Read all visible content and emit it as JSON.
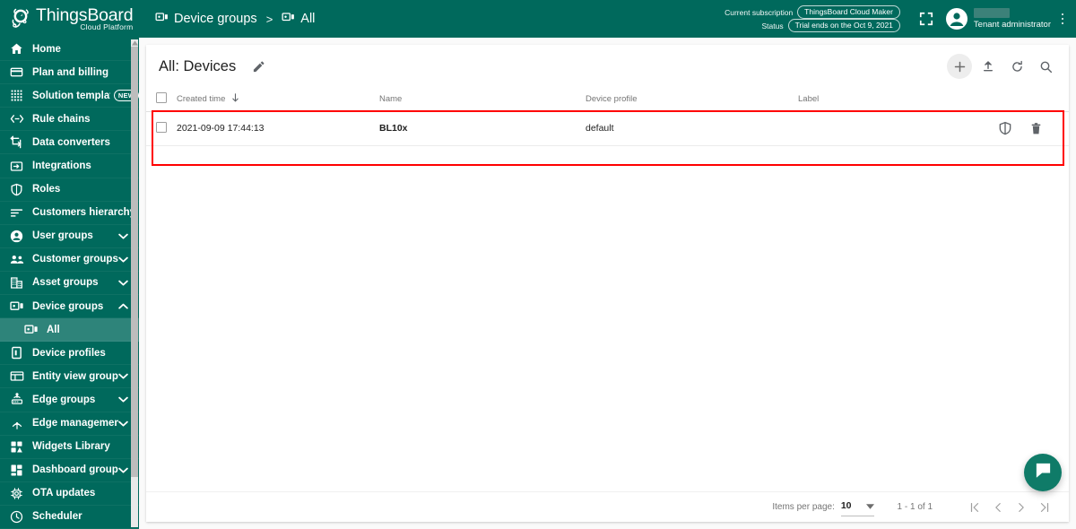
{
  "brand": {
    "name": "ThingsBoard",
    "tagline": "Cloud Platform",
    "accent_color": "#00695C",
    "active_item_color": "#2e847a",
    "highlight_color": "#ff0000",
    "chat_color": "#0f7b68"
  },
  "breadcrumb": [
    {
      "label": "Device groups",
      "icon": "device-groups-icon"
    },
    {
      "label": "All",
      "icon": "device-groups-icon"
    }
  ],
  "breadcrumb_separator": ">",
  "subscription": {
    "current_label": "Current subscription",
    "current_value": "ThingsBoard Cloud Maker",
    "status_label": "Status",
    "status_value": "Trial ends on the Oct 9, 2021"
  },
  "user": {
    "role": "Tenant administrator",
    "name_redacted": true
  },
  "sidebar": {
    "items": [
      {
        "label": "Home",
        "icon": "home-icon",
        "expandable": false,
        "active": false,
        "child": false
      },
      {
        "label": "Plan and billing",
        "icon": "credit-card-icon",
        "expandable": false,
        "active": false,
        "child": false
      },
      {
        "label": "Solution templates",
        "icon": "grid-dots-icon",
        "expandable": false,
        "active": false,
        "child": false,
        "badge": "NEW"
      },
      {
        "label": "Rule chains",
        "icon": "rule-chains-icon",
        "expandable": false,
        "active": false,
        "child": false
      },
      {
        "label": "Data converters",
        "icon": "data-converters-icon",
        "expandable": false,
        "active": false,
        "child": false
      },
      {
        "label": "Integrations",
        "icon": "integrations-icon",
        "expandable": false,
        "active": false,
        "child": false
      },
      {
        "label": "Roles",
        "icon": "shield-icon",
        "expandable": false,
        "active": false,
        "child": false
      },
      {
        "label": "Customers hierarchy",
        "icon": "hierarchy-icon",
        "expandable": false,
        "active": false,
        "child": false
      },
      {
        "label": "User groups",
        "icon": "user-icon",
        "expandable": true,
        "expanded": false,
        "active": false,
        "child": false
      },
      {
        "label": "Customer groups",
        "icon": "users-icon",
        "expandable": true,
        "expanded": false,
        "active": false,
        "child": false
      },
      {
        "label": "Asset groups",
        "icon": "building-icon",
        "expandable": true,
        "expanded": false,
        "active": false,
        "child": false
      },
      {
        "label": "Device groups",
        "icon": "device-groups-icon",
        "expandable": true,
        "expanded": true,
        "active": false,
        "child": false
      },
      {
        "label": "All",
        "icon": "device-groups-icon",
        "expandable": false,
        "active": true,
        "child": true
      },
      {
        "label": "Device profiles",
        "icon": "device-profile-icon",
        "expandable": false,
        "active": false,
        "child": false
      },
      {
        "label": "Entity view groups",
        "icon": "entity-view-icon",
        "expandable": true,
        "expanded": false,
        "active": false,
        "child": false
      },
      {
        "label": "Edge groups",
        "icon": "edge-groups-icon",
        "expandable": true,
        "expanded": false,
        "active": false,
        "child": false
      },
      {
        "label": "Edge management",
        "icon": "edge-management-icon",
        "expandable": true,
        "expanded": false,
        "active": false,
        "child": false
      },
      {
        "label": "Widgets Library",
        "icon": "widgets-icon",
        "expandable": false,
        "active": false,
        "child": false
      },
      {
        "label": "Dashboard groups",
        "icon": "dashboard-icon",
        "expandable": true,
        "expanded": false,
        "active": false,
        "child": false
      },
      {
        "label": "OTA updates",
        "icon": "ota-updates-icon",
        "expandable": false,
        "active": false,
        "child": false
      },
      {
        "label": "Scheduler",
        "icon": "clock-icon",
        "expandable": false,
        "active": false,
        "child": false
      }
    ]
  },
  "content": {
    "title": "All: Devices",
    "actions": [
      {
        "name": "add-device-button",
        "icon": "plus-icon"
      },
      {
        "name": "import-devices-button",
        "icon": "upload-icon"
      },
      {
        "name": "refresh-button",
        "icon": "refresh-icon"
      },
      {
        "name": "search-button",
        "icon": "search-icon"
      }
    ],
    "table": {
      "columns": [
        "Created time",
        "Name",
        "Device profile",
        "Label"
      ],
      "sorted_column": "Created time",
      "sort_direction": "desc",
      "rows": [
        {
          "created_time": "2021-09-09 17:44:13",
          "name": "BL10x",
          "device_profile": "default",
          "label": "",
          "selected": false
        }
      ]
    },
    "footer": {
      "items_per_page_label": "Items per page:",
      "items_per_page_value": "10",
      "range_label": "1 - 1 of 1",
      "first_page": "|<",
      "prev_page": "<",
      "next_page": ">",
      "last_page": ">|"
    }
  }
}
